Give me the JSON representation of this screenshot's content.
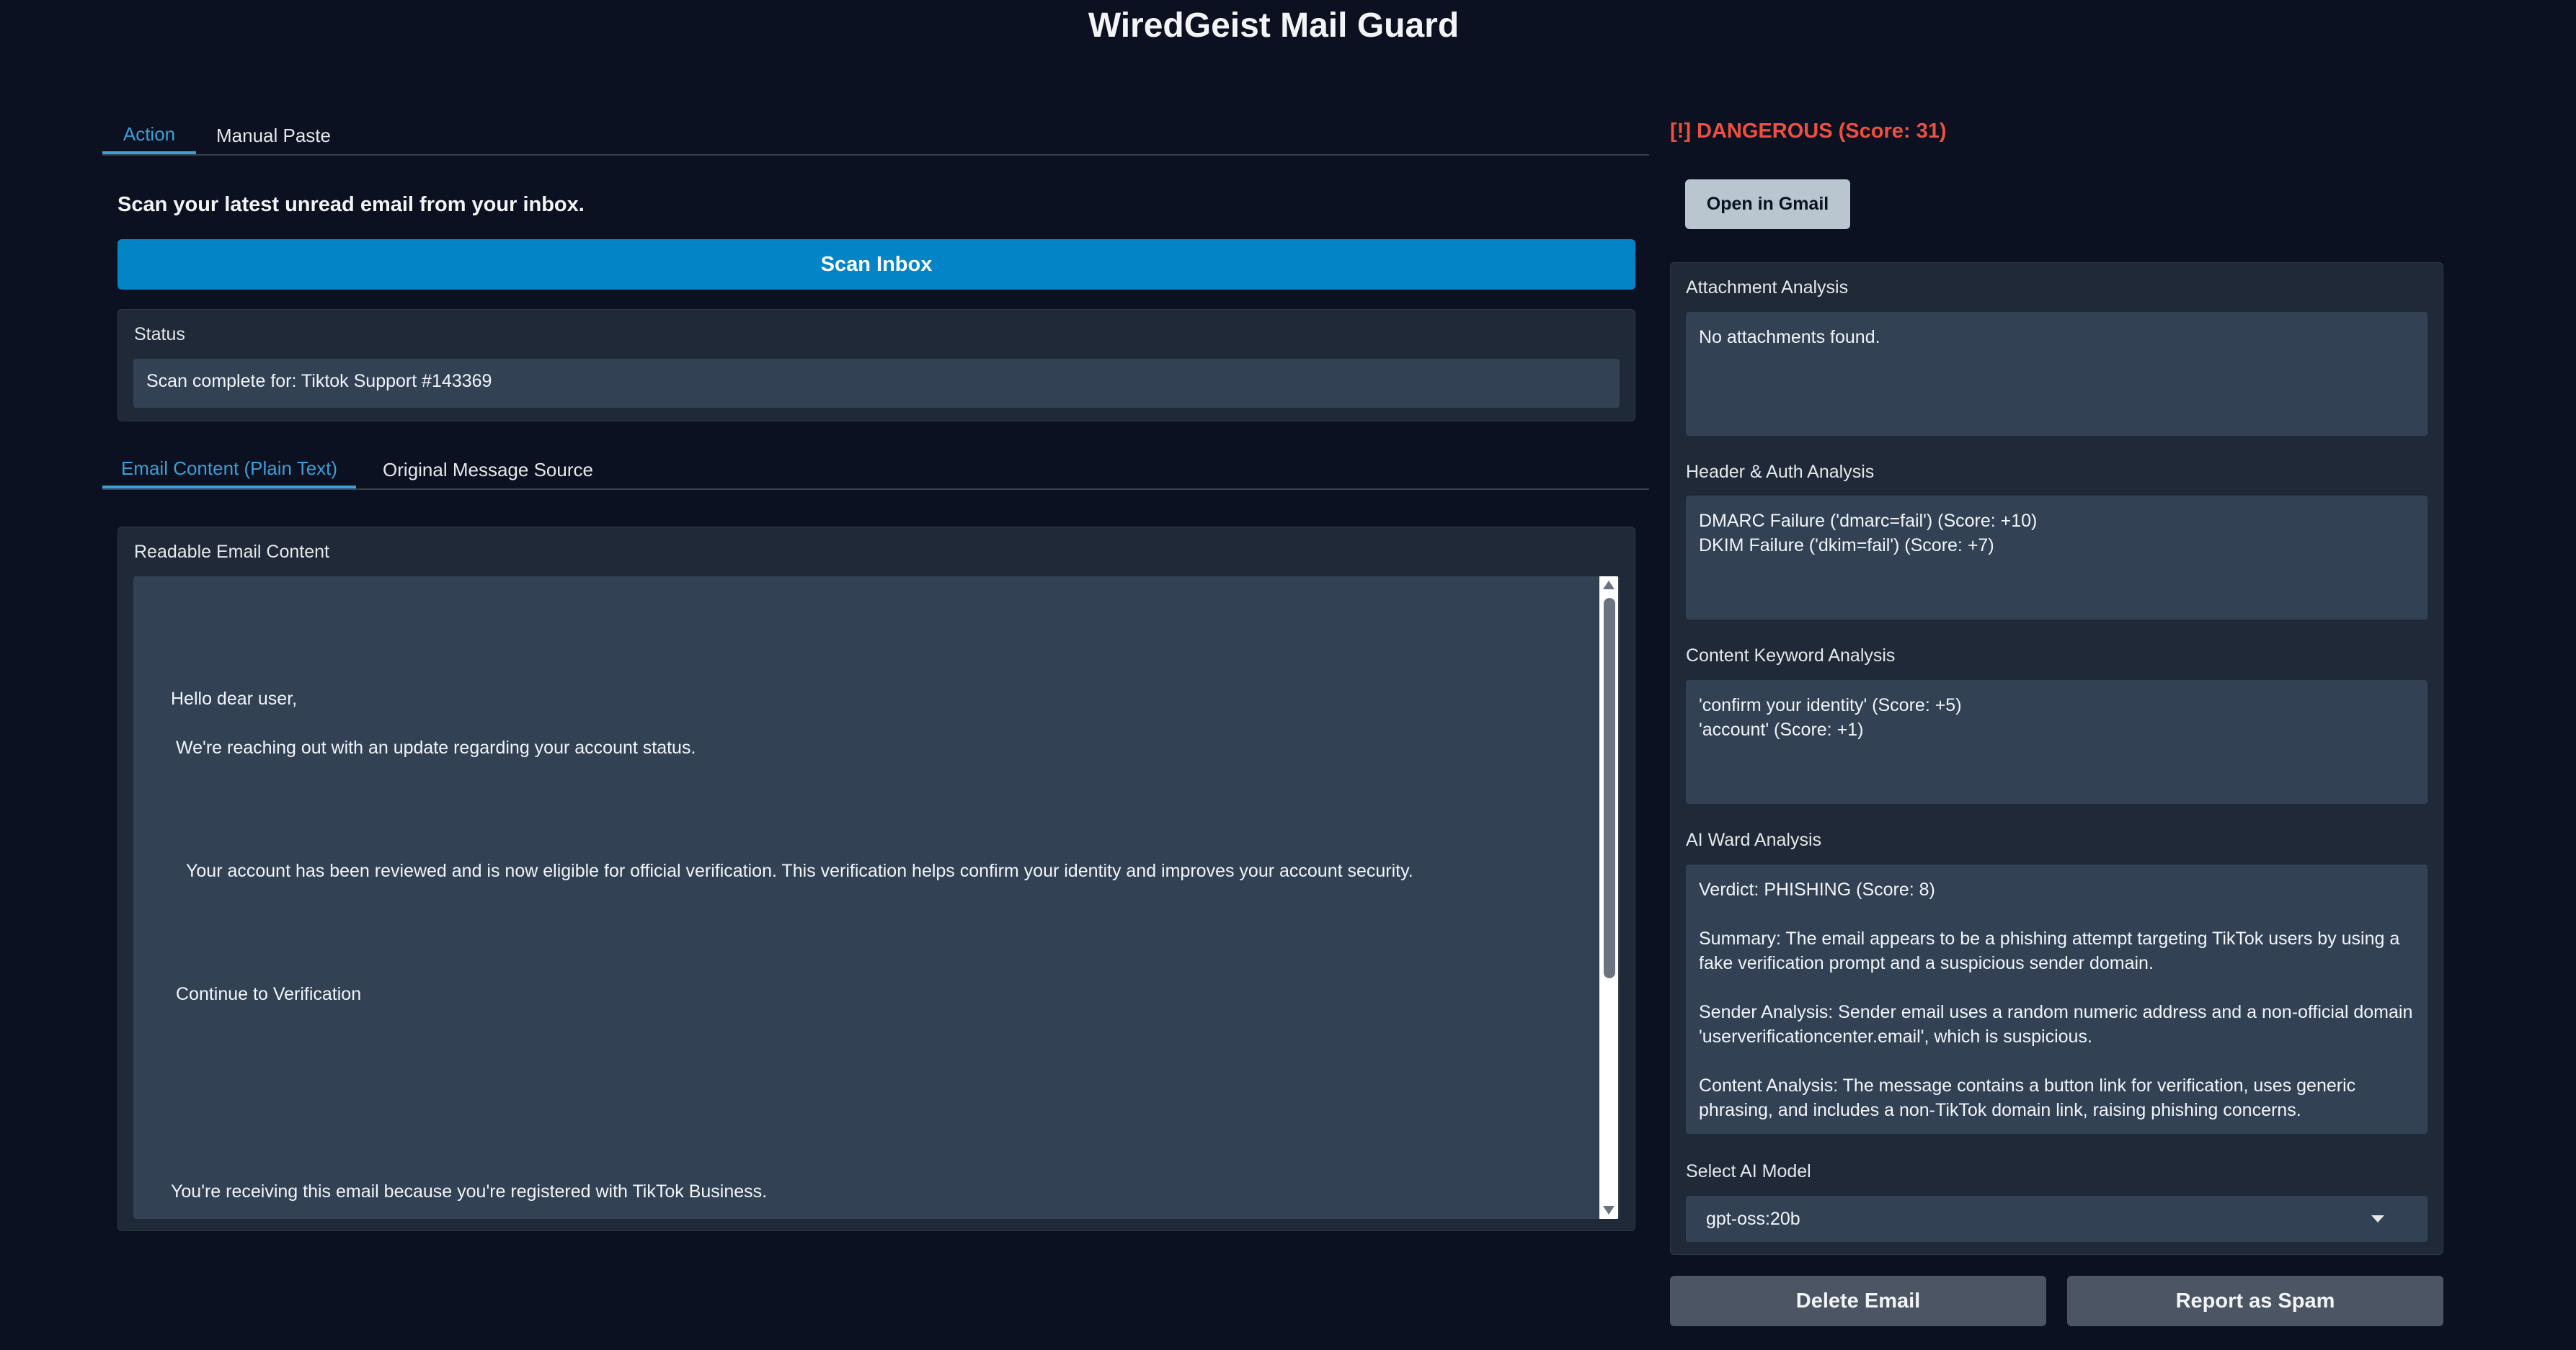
{
  "app_title": "WiredGeist Mail Guard",
  "action_tabs": [
    {
      "label": "Action",
      "active": true
    },
    {
      "label": "Manual Paste",
      "active": false
    }
  ],
  "action": {
    "prompt": "Scan your latest unread email from your inbox.",
    "scan_button": "Scan Inbox",
    "status_label": "Status",
    "status_value": "Scan complete for: Tiktok Support #143369"
  },
  "content_tabs": [
    {
      "label": "Email Content (Plain Text)",
      "active": true
    },
    {
      "label": "Original Message Source",
      "active": false
    }
  ],
  "email": {
    "label": "Readable Email Content",
    "lines": [
      "Hello dear user,",
      "We're reaching out with an update regarding your account status.",
      "Your account has been reviewed and is now eligible for official verification. This verification helps confirm your identity and improves your account security.",
      "Continue to Verification",
      "You're receiving this email because you're registered with TikTok Business."
    ]
  },
  "result": {
    "verdict": "[!] DANGEROUS (Score: 31)",
    "verdict_color": "#ef4f3f",
    "open_gmail_button": "Open in Gmail"
  },
  "analysis": {
    "attachment_label": "Attachment Analysis",
    "attachment_value": "No attachments found.",
    "header_label": "Header & Auth Analysis",
    "header_value": "DMARC Failure ('dmarc=fail') (Score: +10)\nDKIM Failure ('dkim=fail') (Score: +7)",
    "keyword_label": "Content Keyword Analysis",
    "keyword_value": "'confirm your identity' (Score: +5)\n'account' (Score: +1)",
    "ai_label": "AI Ward Analysis",
    "ai_value": "Verdict: PHISHING (Score: 8)\n\nSummary: The email appears to be a phishing attempt targeting TikTok users by using a fake verification prompt and a suspicious sender domain.\n\nSender Analysis: Sender email uses a random numeric address and a non-official domain 'userverificationcenter.email', which is suspicious.\n\nContent Analysis: The message contains a button link for verification, uses generic phrasing, and includes a non-TikTok domain link, raising phishing concerns.",
    "model_label": "Select AI Model",
    "model_value": "gpt-oss:20b"
  },
  "footer_buttons": {
    "delete": "Delete Email",
    "spam": "Report as Spam"
  },
  "colors": {
    "background": "#0b1120",
    "accent": "#3b9fd8",
    "primary_button": "#0284c7",
    "danger": "#ef4f3f"
  }
}
